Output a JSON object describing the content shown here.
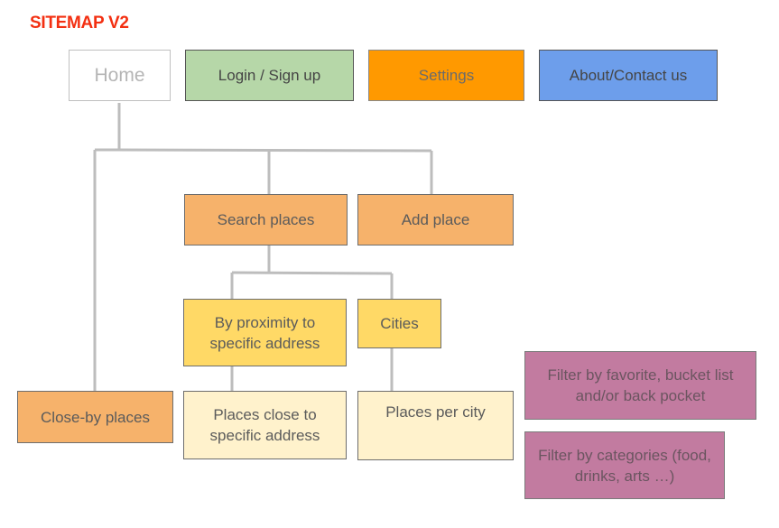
{
  "title": "SITEMAP V2",
  "colors": {
    "title": "#f33012",
    "connector": "#bdbdbd",
    "home": "#ffffff",
    "login": "#b6d7a8",
    "settings": "#ff9900",
    "about": "#6d9eeb",
    "level1": "#f6b26b",
    "level2": "#ffd966",
    "level3": "#fff2cc",
    "filters": "#c27ba0"
  },
  "nodes": {
    "home": "Home",
    "login": "Login / Sign up",
    "settings": "Settings",
    "about": "About/Contact us",
    "search_places": "Search places",
    "add_place": "Add place",
    "by_proximity": "By proximity to specific address",
    "cities": "Cities",
    "close_by_places": "Close-by places",
    "places_close_to_address": "Places close to specific address",
    "places_per_city": "Places per city",
    "filter_favorite": "Filter by favorite, bucket list and/or back pocket",
    "filter_categories": "Filter by categories (food, drinks, arts …)"
  },
  "edges": [
    [
      "home",
      "close_by_places"
    ],
    [
      "home",
      "search_places"
    ],
    [
      "home",
      "add_place"
    ],
    [
      "search_places",
      "by_proximity"
    ],
    [
      "search_places",
      "cities"
    ],
    [
      "by_proximity",
      "places_close_to_address"
    ],
    [
      "cities",
      "places_per_city"
    ]
  ]
}
